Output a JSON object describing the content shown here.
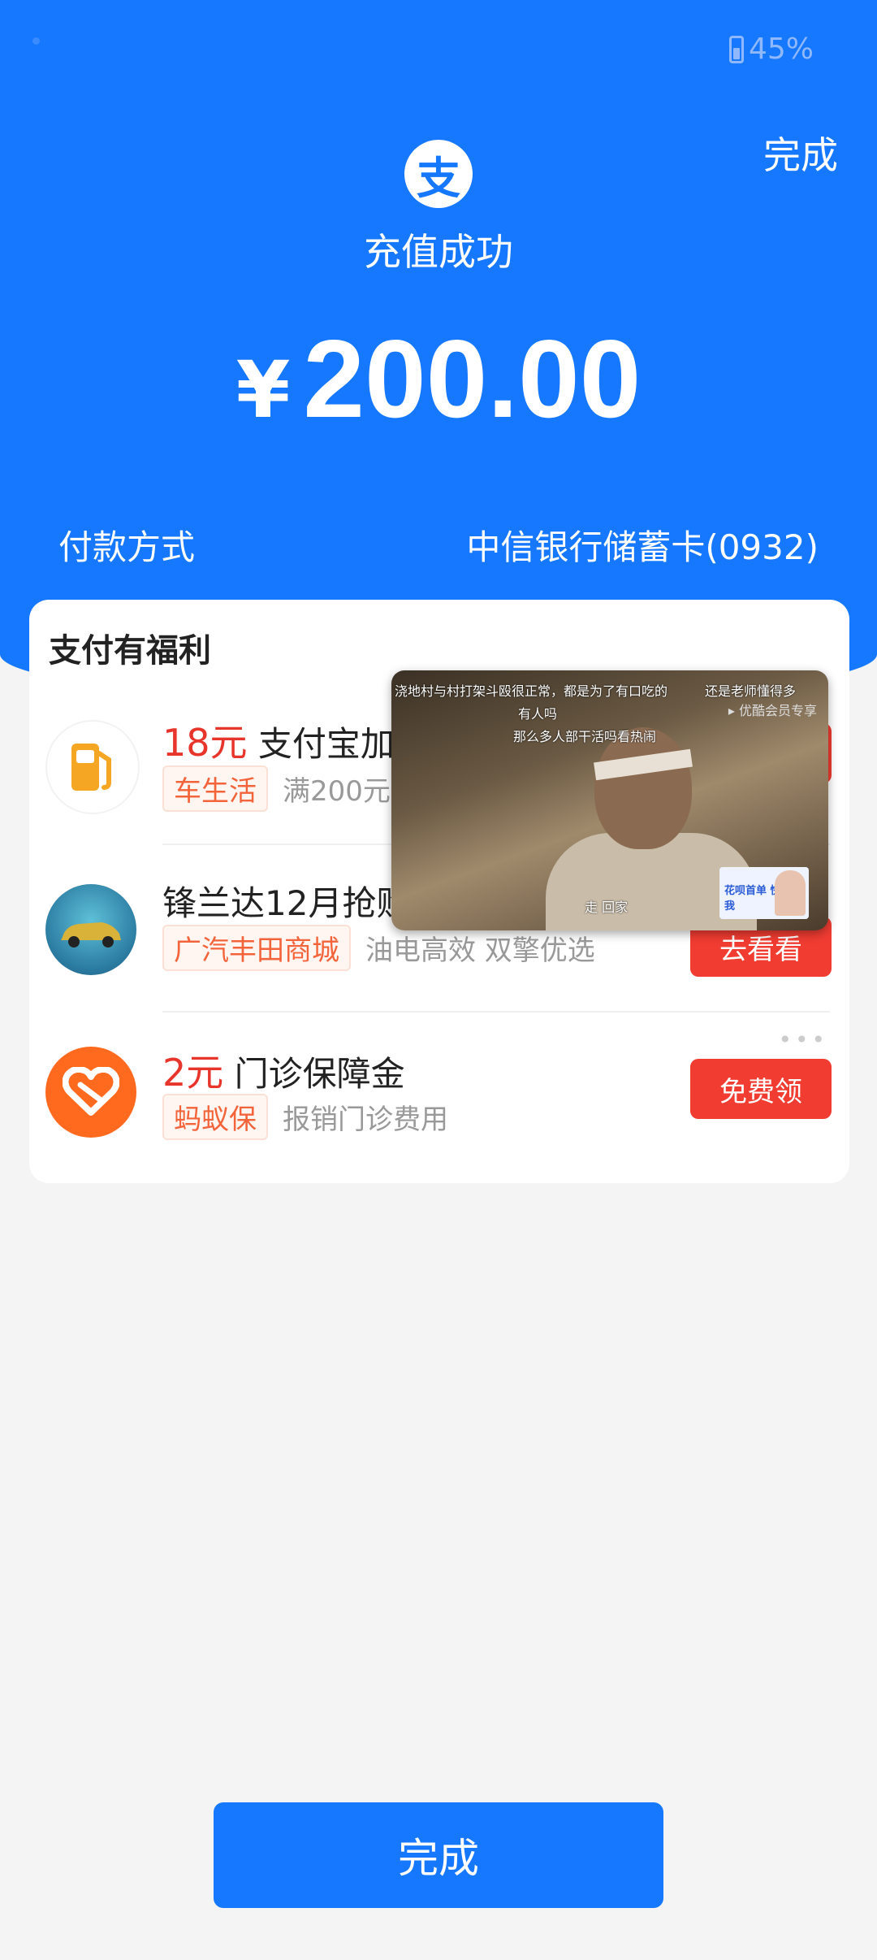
{
  "status_bar": {
    "battery": "45%"
  },
  "header": {
    "done_label": "完成",
    "logo_glyph": "支",
    "success_text": "充值成功",
    "currency": "¥",
    "amount": "200.00",
    "payment_label": "付款方式",
    "payment_value": "中信银行储蓄卡(0932)"
  },
  "benefits": {
    "title": "支付有福利",
    "items": [
      {
        "price": "18元",
        "title": "支付宝加油",
        "tag": "车生活",
        "desc": "满200元可用",
        "button": "",
        "icon": "gas-pump-icon"
      },
      {
        "price": "",
        "title": "锋兰达12月抢购",
        "tag": "广汽丰田商城",
        "desc": "油电高效 双擎优选",
        "button": "去看看",
        "icon": "car-ad-icon"
      },
      {
        "price": "2元",
        "title": "门诊保障金",
        "tag": "蚂蚁保",
        "desc": "报销门诊费用",
        "button": "免费领",
        "icon": "heart-shield-icon"
      }
    ]
  },
  "video_overlay": {
    "subtitle_1": "浇地村与村打架斗殴很正常，都是为了有口吃的",
    "subtitle_2": "有人吗",
    "subtitle_3": "那么多人部干活吗看热闹",
    "subtitle_4": "还是老师懂得多",
    "vip_label": "优酷会员专享",
    "bottom_caption": "走 回家",
    "ad_text": "花呗首单 快来看我"
  },
  "footer": {
    "done_button": "完成"
  },
  "colors": {
    "brand_blue": "#1677ff",
    "accent_red": "#f13c32",
    "tag_orange": "#f4643a"
  }
}
